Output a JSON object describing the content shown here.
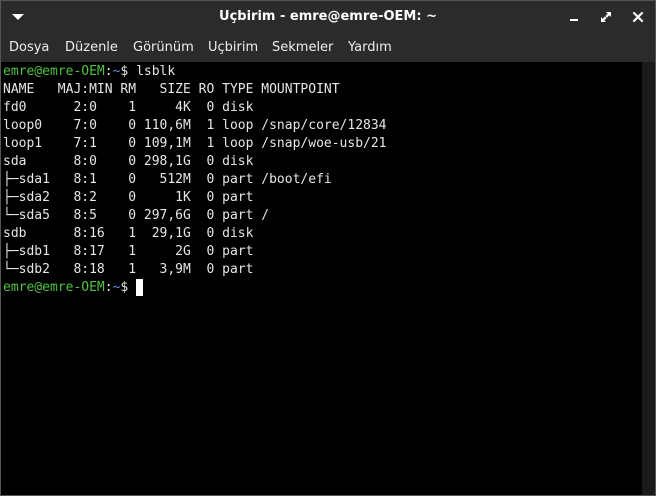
{
  "window": {
    "title": "Uçbirim - emre@emre-OEM: ~",
    "menu_icon": "chevron-down-icon",
    "controls": {
      "minimize_icon": "minimize-icon",
      "maximize_icon": "maximize-icon",
      "close_icon": "close-icon"
    }
  },
  "menubar": {
    "items": [
      {
        "label": "Dosya"
      },
      {
        "label": "Düzenle"
      },
      {
        "label": "Görünüm"
      },
      {
        "label": "Uçbirim"
      },
      {
        "label": "Sekmeler"
      },
      {
        "label": "Yardım"
      }
    ]
  },
  "terminal": {
    "prompt_user": "emre@emre-OEM",
    "prompt_sep": ":",
    "prompt_path": "~",
    "prompt_symbol": "$",
    "command": "lsblk",
    "output_lines": [
      "NAME   MAJ:MIN RM   SIZE RO TYPE MOUNTPOINT",
      "fd0      2:0    1     4K  0 disk",
      "loop0    7:0    0 110,6M  1 loop /snap/core/12834",
      "loop1    7:1    0 109,1M  1 loop /snap/woe-usb/21",
      "sda      8:0    0 298,1G  0 disk",
      "├─sda1   8:1    0   512M  0 part /boot/efi",
      "├─sda2   8:2    0     1K  0 part",
      "└─sda5   8:5    0 297,6G  0 part /",
      "sdb      8:16   1  29,1G  0 disk",
      "├─sdb1   8:17   1     2G  0 part",
      "└─sdb2   8:18   1   3,9M  0 part"
    ]
  },
  "colors": {
    "titlebar_bg": "#2b2b2b",
    "terminal_bg": "#000000",
    "text": "#e6e6e6",
    "prompt_user": "#4ec23e",
    "prompt_path": "#5b8fe3"
  }
}
